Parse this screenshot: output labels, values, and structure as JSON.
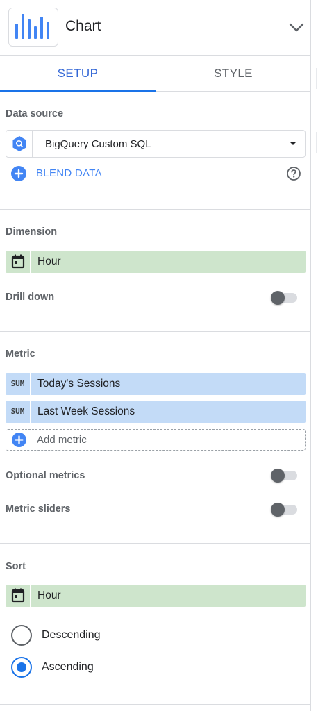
{
  "header": {
    "title": "Chart",
    "icon": "bar-chart-icon",
    "collapse_icon": "chevron-down-icon"
  },
  "tabs": [
    {
      "label": "SETUP",
      "active": true
    },
    {
      "label": "STYLE",
      "active": false
    }
  ],
  "data_source": {
    "section_label": "Data source",
    "name": "BigQuery Custom SQL",
    "icon": "bigquery-icon",
    "blend_label": "BLEND DATA",
    "help_icon": "help-icon"
  },
  "dimension": {
    "section_label": "Dimension",
    "field": "Hour",
    "field_icon": "calendar-icon",
    "drill_down_label": "Drill down",
    "drill_down_on": false
  },
  "metric": {
    "section_label": "Metric",
    "items": [
      {
        "agg": "SUM",
        "name": "Today's Sessions"
      },
      {
        "agg": "SUM",
        "name": "Last Week Sessions"
      }
    ],
    "add_label": "Add metric",
    "optional_metrics_label": "Optional metrics",
    "optional_metrics_on": false,
    "metric_sliders_label": "Metric sliders",
    "metric_sliders_on": false
  },
  "sort": {
    "section_label": "Sort",
    "field": "Hour",
    "field_icon": "calendar-icon",
    "options": [
      {
        "label": "Descending",
        "selected": false
      },
      {
        "label": "Ascending",
        "selected": true
      }
    ]
  },
  "colors": {
    "accent": "#1a73e8",
    "dimension_chip": "#cee5cc",
    "metric_chip": "#c3dbf7"
  }
}
